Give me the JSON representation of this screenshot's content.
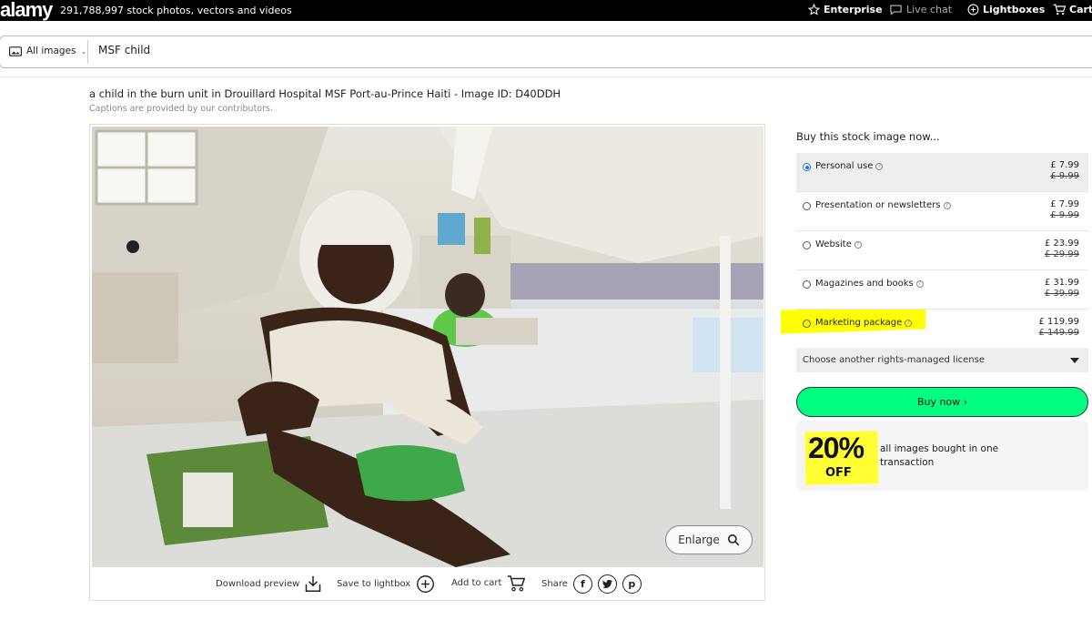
{
  "topbar": {
    "logo": "alamy",
    "stock_count": "291,788,997 stock photos, vectors and videos",
    "enterprise": "Enterprise",
    "live_chat": "Live chat",
    "lightboxes": "Lightboxes",
    "cart": "Cart"
  },
  "search": {
    "filter_label": "All images",
    "query": "MSF child"
  },
  "image": {
    "caption": "a child in the burn unit in Drouillard Hospital MSF Port-au-Prince Haiti - Image ID: D40DDH",
    "caption_note": "Captions are provided by our contributors.",
    "enlarge_label": "Enlarge"
  },
  "actions": {
    "download_preview": "Download preview",
    "save_to_lightbox": "Save to lightbox",
    "add_to_cart": "Add to cart",
    "share": "Share"
  },
  "buy_panel": {
    "heading": "Buy this stock image now...",
    "options": [
      {
        "label": "Personal use",
        "price": "£ 7.99",
        "old_price": "£ 9.99",
        "selected": true
      },
      {
        "label": "Presentation or newsletters",
        "price": "£ 7.99",
        "old_price": "£ 9.99",
        "selected": false
      },
      {
        "label": "Website",
        "price": "£ 23.99",
        "old_price": "£ 29.99",
        "selected": false
      },
      {
        "label": "Magazines and books",
        "price": "£ 31.99",
        "old_price": "£ 39.99",
        "selected": false
      },
      {
        "label": "Marketing package",
        "price": "£ 119.99",
        "old_price": "£ 149.99",
        "selected": false
      }
    ],
    "other_license": "Choose another rights-managed license",
    "buy_button": "Buy now ›",
    "promo_percent": "20%",
    "promo_off": "OFF",
    "promo_text": "all images bought in one transaction"
  },
  "colors": {
    "buy_button": "#00ff80",
    "highlight": "#ffff00",
    "radio_selected": "#1a73e8"
  }
}
